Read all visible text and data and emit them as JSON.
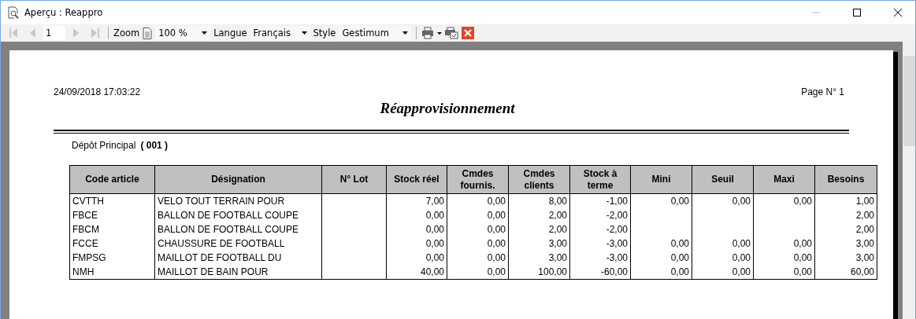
{
  "window": {
    "title": "Aperçu : Reappro"
  },
  "toolbar": {
    "nav": [
      {
        "kind": "first",
        "disabled": true
      },
      {
        "kind": "prev",
        "disabled": true
      },
      {
        "kind": "page",
        "value": "1"
      },
      {
        "kind": "next",
        "disabled": true
      },
      {
        "kind": "last",
        "disabled": true
      }
    ],
    "zoom_label": "Zoom",
    "zoom_value": "100 %",
    "language_label": "Langue",
    "language_value": "Français",
    "style_label": "Style",
    "style_value": "Gestimum"
  },
  "report": {
    "date": "24/09/2018 17:03:22",
    "page": "Page N° 1",
    "title": "Réapprovisionnement",
    "depot_label": "Dépôt Principal",
    "depot_code": "(  001  )",
    "columns": [
      "Code article",
      "Désignation",
      "N° Lot",
      "Stock réel",
      "Cmdes fournis.",
      "Cmdes clients",
      "Stock à terme",
      "Mini",
      "Seuil",
      "Maxi",
      "Besoins"
    ],
    "rows": [
      [
        "CVTTH",
        "VELO TOUT TERRAIN POUR",
        null,
        "7,00",
        "0,00",
        "8,00",
        "-1,00",
        "0,00",
        "0,00",
        "0,00",
        "1,00"
      ],
      [
        "FBCE",
        "BALLON DE FOOTBALL COUPE",
        null,
        "0,00",
        "0,00",
        "2,00",
        "-2,00",
        null,
        null,
        null,
        "2,00"
      ],
      [
        "FBCM",
        "BALLON DE FOOTBALL COUPE",
        null,
        "0,00",
        "0,00",
        "2,00",
        "-2,00",
        null,
        null,
        null,
        "2,00"
      ],
      [
        "FCCE",
        "CHAUSSURE DE FOOTBALL",
        null,
        "0,00",
        "0,00",
        "3,00",
        "-3,00",
        "0,00",
        "0,00",
        "0,00",
        "3,00"
      ],
      [
        "FMPSG",
        "MAILLOT DE FOOTBALL DU",
        null,
        "0,00",
        "0,00",
        "3,00",
        "-3,00",
        "0,00",
        "0,00",
        "0,00",
        "3,00"
      ],
      [
        "NMH",
        "MAILLOT DE BAIN POUR",
        null,
        "40,00",
        "0,00",
        "100,00",
        "-60,00",
        "0,00",
        "0,00",
        "0,00",
        "60,00"
      ]
    ]
  }
}
